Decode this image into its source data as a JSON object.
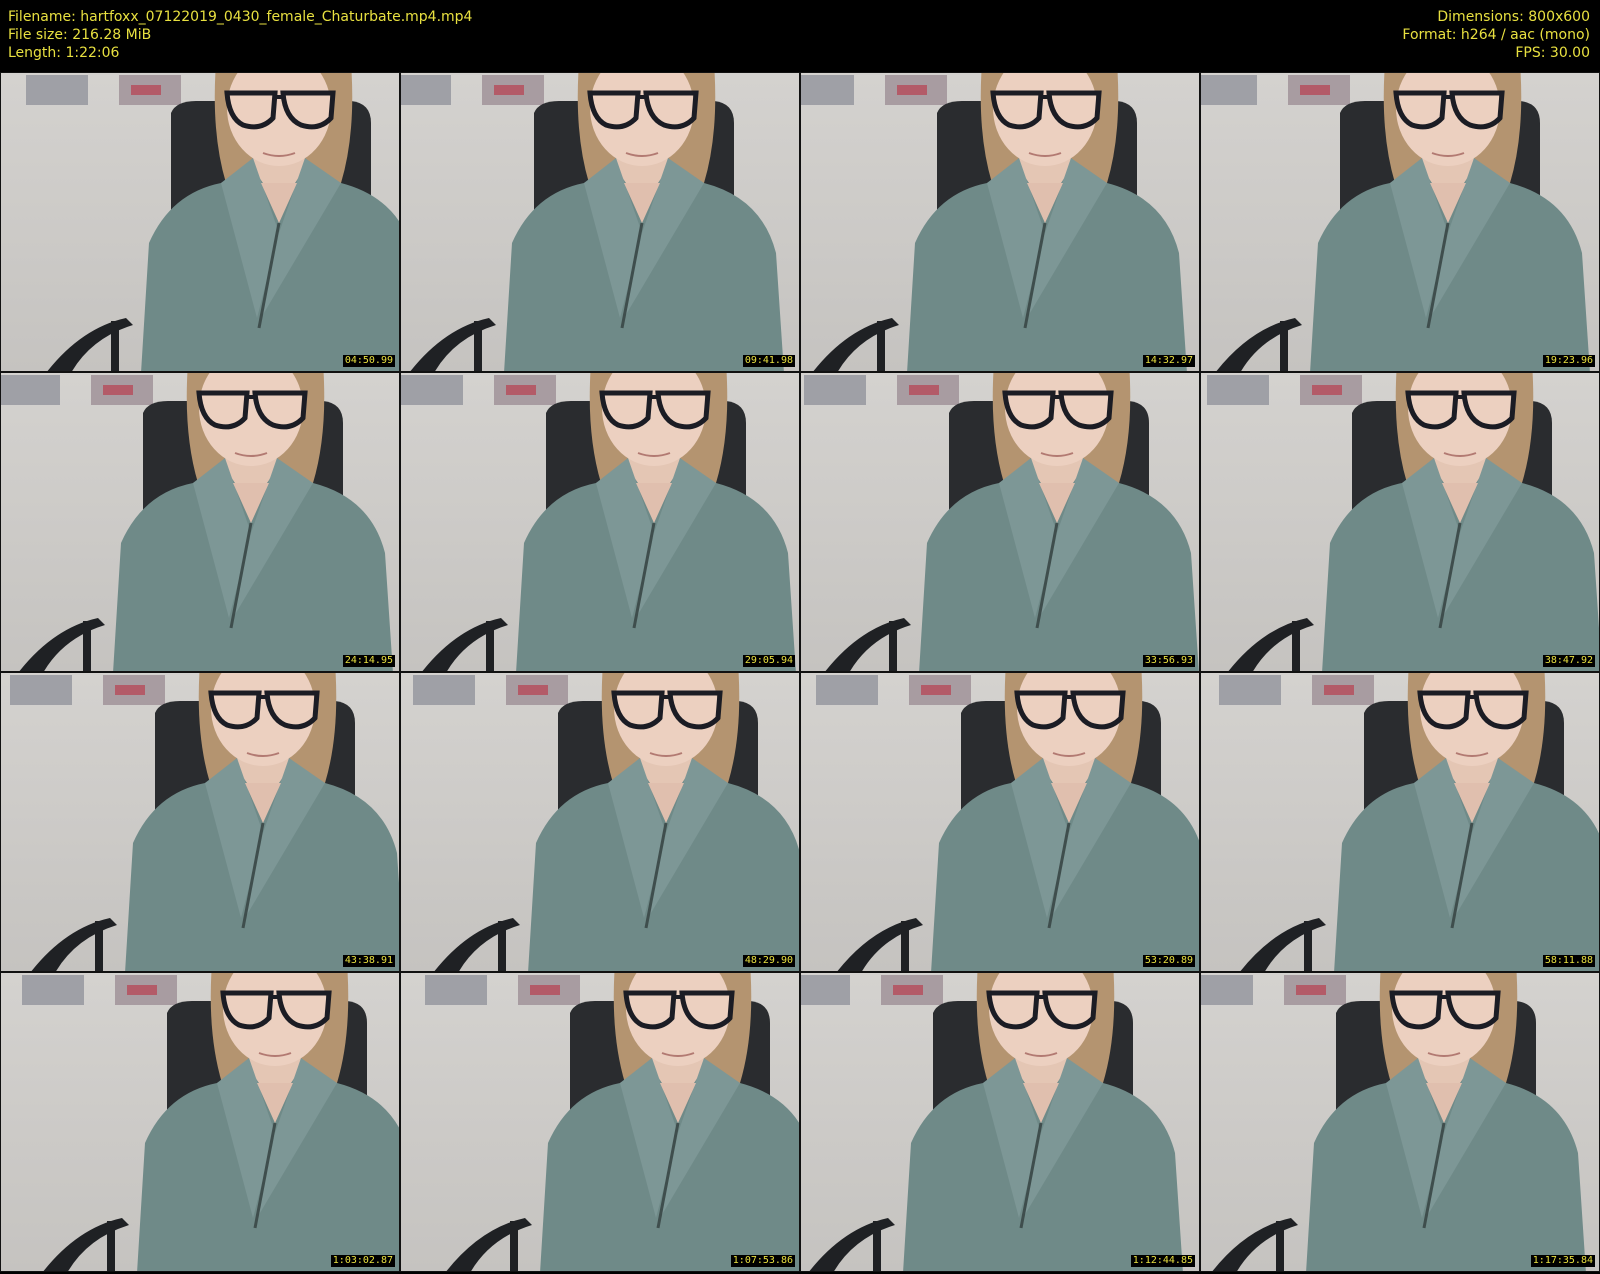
{
  "header": {
    "filename": "Filename: hartfoxx_07122019_0430_female_Chaturbate.mp4.mp4",
    "filesize": "File size: 216.28 MiB",
    "length": "Length: 1:22:06",
    "dimensions": "Dimensions: 800x600",
    "format": "Format: h264 / aac (mono)",
    "fps": "FPS: 30.00"
  },
  "colors": {
    "text": "#e8e040",
    "background": "#000000",
    "sweater": "#6f8a88",
    "wall": "#cfcdca"
  },
  "thumbnails": [
    {
      "timestamp": "04:50.99"
    },
    {
      "timestamp": "09:41.98"
    },
    {
      "timestamp": "14:32.97"
    },
    {
      "timestamp": "19:23.96"
    },
    {
      "timestamp": "24:14.95"
    },
    {
      "timestamp": "29:05.94"
    },
    {
      "timestamp": "33:56.93"
    },
    {
      "timestamp": "38:47.92"
    },
    {
      "timestamp": "43:38.91"
    },
    {
      "timestamp": "48:29.90"
    },
    {
      "timestamp": "53:20.89"
    },
    {
      "timestamp": "58:11.88"
    },
    {
      "timestamp": "1:03:02.87"
    },
    {
      "timestamp": "1:07:53.86"
    },
    {
      "timestamp": "1:12:44.85"
    },
    {
      "timestamp": "1:17:35.84"
    }
  ]
}
